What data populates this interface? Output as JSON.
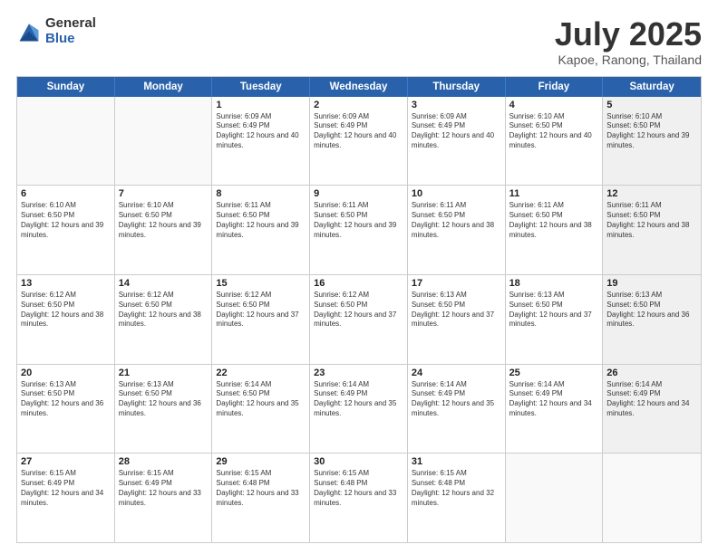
{
  "logo": {
    "general": "General",
    "blue": "Blue"
  },
  "header": {
    "month": "July 2025",
    "location": "Kapoe, Ranong, Thailand"
  },
  "weekdays": [
    "Sunday",
    "Monday",
    "Tuesday",
    "Wednesday",
    "Thursday",
    "Friday",
    "Saturday"
  ],
  "weeks": [
    [
      {
        "day": "",
        "info": "",
        "empty": true
      },
      {
        "day": "",
        "info": "",
        "empty": true
      },
      {
        "day": "1",
        "info": "Sunrise: 6:09 AM\nSunset: 6:49 PM\nDaylight: 12 hours and 40 minutes.",
        "empty": false
      },
      {
        "day": "2",
        "info": "Sunrise: 6:09 AM\nSunset: 6:49 PM\nDaylight: 12 hours and 40 minutes.",
        "empty": false
      },
      {
        "day": "3",
        "info": "Sunrise: 6:09 AM\nSunset: 6:49 PM\nDaylight: 12 hours and 40 minutes.",
        "empty": false
      },
      {
        "day": "4",
        "info": "Sunrise: 6:10 AM\nSunset: 6:50 PM\nDaylight: 12 hours and 40 minutes.",
        "empty": false
      },
      {
        "day": "5",
        "info": "Sunrise: 6:10 AM\nSunset: 6:50 PM\nDaylight: 12 hours and 39 minutes.",
        "empty": false,
        "shaded": true
      }
    ],
    [
      {
        "day": "6",
        "info": "Sunrise: 6:10 AM\nSunset: 6:50 PM\nDaylight: 12 hours and 39 minutes.",
        "empty": false
      },
      {
        "day": "7",
        "info": "Sunrise: 6:10 AM\nSunset: 6:50 PM\nDaylight: 12 hours and 39 minutes.",
        "empty": false
      },
      {
        "day": "8",
        "info": "Sunrise: 6:11 AM\nSunset: 6:50 PM\nDaylight: 12 hours and 39 minutes.",
        "empty": false
      },
      {
        "day": "9",
        "info": "Sunrise: 6:11 AM\nSunset: 6:50 PM\nDaylight: 12 hours and 39 minutes.",
        "empty": false
      },
      {
        "day": "10",
        "info": "Sunrise: 6:11 AM\nSunset: 6:50 PM\nDaylight: 12 hours and 38 minutes.",
        "empty": false
      },
      {
        "day": "11",
        "info": "Sunrise: 6:11 AM\nSunset: 6:50 PM\nDaylight: 12 hours and 38 minutes.",
        "empty": false
      },
      {
        "day": "12",
        "info": "Sunrise: 6:11 AM\nSunset: 6:50 PM\nDaylight: 12 hours and 38 minutes.",
        "empty": false,
        "shaded": true
      }
    ],
    [
      {
        "day": "13",
        "info": "Sunrise: 6:12 AM\nSunset: 6:50 PM\nDaylight: 12 hours and 38 minutes.",
        "empty": false
      },
      {
        "day": "14",
        "info": "Sunrise: 6:12 AM\nSunset: 6:50 PM\nDaylight: 12 hours and 38 minutes.",
        "empty": false
      },
      {
        "day": "15",
        "info": "Sunrise: 6:12 AM\nSunset: 6:50 PM\nDaylight: 12 hours and 37 minutes.",
        "empty": false
      },
      {
        "day": "16",
        "info": "Sunrise: 6:12 AM\nSunset: 6:50 PM\nDaylight: 12 hours and 37 minutes.",
        "empty": false
      },
      {
        "day": "17",
        "info": "Sunrise: 6:13 AM\nSunset: 6:50 PM\nDaylight: 12 hours and 37 minutes.",
        "empty": false
      },
      {
        "day": "18",
        "info": "Sunrise: 6:13 AM\nSunset: 6:50 PM\nDaylight: 12 hours and 37 minutes.",
        "empty": false
      },
      {
        "day": "19",
        "info": "Sunrise: 6:13 AM\nSunset: 6:50 PM\nDaylight: 12 hours and 36 minutes.",
        "empty": false,
        "shaded": true
      }
    ],
    [
      {
        "day": "20",
        "info": "Sunrise: 6:13 AM\nSunset: 6:50 PM\nDaylight: 12 hours and 36 minutes.",
        "empty": false
      },
      {
        "day": "21",
        "info": "Sunrise: 6:13 AM\nSunset: 6:50 PM\nDaylight: 12 hours and 36 minutes.",
        "empty": false
      },
      {
        "day": "22",
        "info": "Sunrise: 6:14 AM\nSunset: 6:50 PM\nDaylight: 12 hours and 35 minutes.",
        "empty": false
      },
      {
        "day": "23",
        "info": "Sunrise: 6:14 AM\nSunset: 6:49 PM\nDaylight: 12 hours and 35 minutes.",
        "empty": false
      },
      {
        "day": "24",
        "info": "Sunrise: 6:14 AM\nSunset: 6:49 PM\nDaylight: 12 hours and 35 minutes.",
        "empty": false
      },
      {
        "day": "25",
        "info": "Sunrise: 6:14 AM\nSunset: 6:49 PM\nDaylight: 12 hours and 34 minutes.",
        "empty": false
      },
      {
        "day": "26",
        "info": "Sunrise: 6:14 AM\nSunset: 6:49 PM\nDaylight: 12 hours and 34 minutes.",
        "empty": false,
        "shaded": true
      }
    ],
    [
      {
        "day": "27",
        "info": "Sunrise: 6:15 AM\nSunset: 6:49 PM\nDaylight: 12 hours and 34 minutes.",
        "empty": false
      },
      {
        "day": "28",
        "info": "Sunrise: 6:15 AM\nSunset: 6:49 PM\nDaylight: 12 hours and 33 minutes.",
        "empty": false
      },
      {
        "day": "29",
        "info": "Sunrise: 6:15 AM\nSunset: 6:48 PM\nDaylight: 12 hours and 33 minutes.",
        "empty": false
      },
      {
        "day": "30",
        "info": "Sunrise: 6:15 AM\nSunset: 6:48 PM\nDaylight: 12 hours and 33 minutes.",
        "empty": false
      },
      {
        "day": "31",
        "info": "Sunrise: 6:15 AM\nSunset: 6:48 PM\nDaylight: 12 hours and 32 minutes.",
        "empty": false
      },
      {
        "day": "",
        "info": "",
        "empty": true
      },
      {
        "day": "",
        "info": "",
        "empty": true,
        "shaded": true
      }
    ]
  ]
}
